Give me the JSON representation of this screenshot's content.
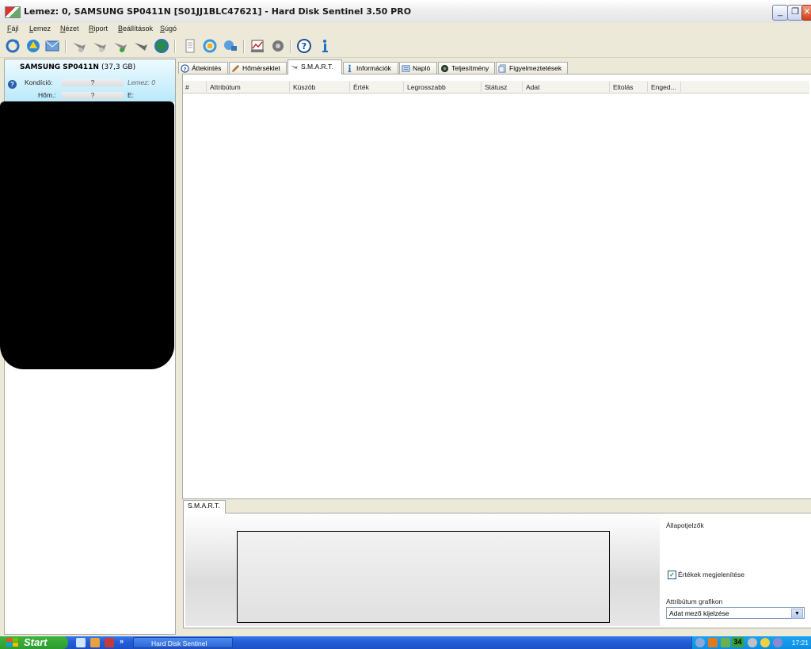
{
  "window": {
    "title": "Lemez: 0, SAMSUNG SP0411N [S01JJ1BLC47621]  -  Hard Disk Sentinel 3.50 PRO",
    "minimize": "_",
    "maximize": "❐",
    "close": "✕"
  },
  "menu": {
    "items": [
      "Fájl",
      "Lemez",
      "Nézet",
      "Riport",
      "Beállítások",
      "Súgó"
    ]
  },
  "left_panel": {
    "disk_name": "SAMSUNG SP0411N",
    "disk_size": "(37,3 GB)",
    "condition_label": "Kondíció:",
    "condition_value": "?",
    "disk_label": "Lemez: 0",
    "temp_label": "Hőm.:",
    "temp_value": "?",
    "drive_letter": "E:"
  },
  "tabs": [
    {
      "label": "Áttekintés",
      "icon": "help-icon"
    },
    {
      "label": "Hőmérséklet",
      "icon": "thermometer-icon"
    },
    {
      "label": "S.M.A.R.T.",
      "icon": "disk-icon",
      "active": true
    },
    {
      "label": "Információk",
      "icon": "info-icon"
    },
    {
      "label": "Napló",
      "icon": "log-icon"
    },
    {
      "label": "Teljesítmény",
      "icon": "performance-icon"
    },
    {
      "label": "Figyelmeztetések",
      "icon": "warning-icon"
    }
  ],
  "grid": {
    "columns": [
      "#",
      "Attribútum",
      "Küszöb",
      "Érték",
      "Legrosszabb",
      "Státusz",
      "Adat",
      "Eltolás",
      "Enged..."
    ],
    "rows": []
  },
  "bottom": {
    "tab_label": "S.M.A.R.T.",
    "status_indicators": "Állapotjelzők",
    "show_values": "Értékek megjelenítése",
    "show_values_checked": true,
    "attr_graph_label": "Attribútum grafikon",
    "attr_graph_value": "Adat mező kijelzése"
  },
  "taskbar": {
    "start": "Start",
    "task": "Hard Disk Sentinel",
    "tray_number": "34",
    "clock": "17:21"
  }
}
